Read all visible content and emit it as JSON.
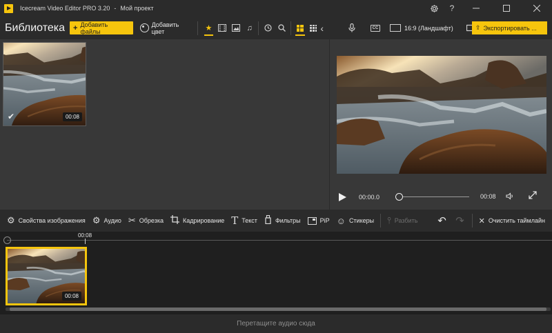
{
  "titlebar": {
    "app_name": "Icecream Video Editor PRO 3.20",
    "separator": "-",
    "project_name": "Мой проект",
    "settings_icon": "gear-icon",
    "help_icon": "question-icon"
  },
  "library": {
    "title": "Библиотека",
    "add_files_label": "Добавить файлы",
    "add_color_label": "Добавить цвет",
    "filters": [
      "star-icon",
      "video-icon",
      "image-icon",
      "music-icon"
    ],
    "items": [
      {
        "duration": "00:08",
        "selected": true
      }
    ]
  },
  "preview": {
    "aspect_ratio_label": "16:9 (Ландшафт)",
    "export_label": "Экспортировать ...",
    "current_time": "00:00.0",
    "duration": "00:08",
    "progress": 0
  },
  "edit_tools": {
    "image_props": "Свойства изображения",
    "audio": "Аудио",
    "trim": "Обрезка",
    "crop": "Кадрирование",
    "text": "Текст",
    "filters": "Фильтры",
    "pip": "PiP",
    "stickers": "Стикеры",
    "split": "Разбить",
    "clear_timeline": "Очистить таймлайн"
  },
  "timeline": {
    "marker_time": "00:08",
    "clips": [
      {
        "duration": "00:08"
      }
    ]
  },
  "audio_track": {
    "drop_hint": "Перетащите аудио сюда"
  },
  "colors": {
    "accent": "#f6c50d",
    "background": "#2b2b2b",
    "panel": "#383838"
  }
}
